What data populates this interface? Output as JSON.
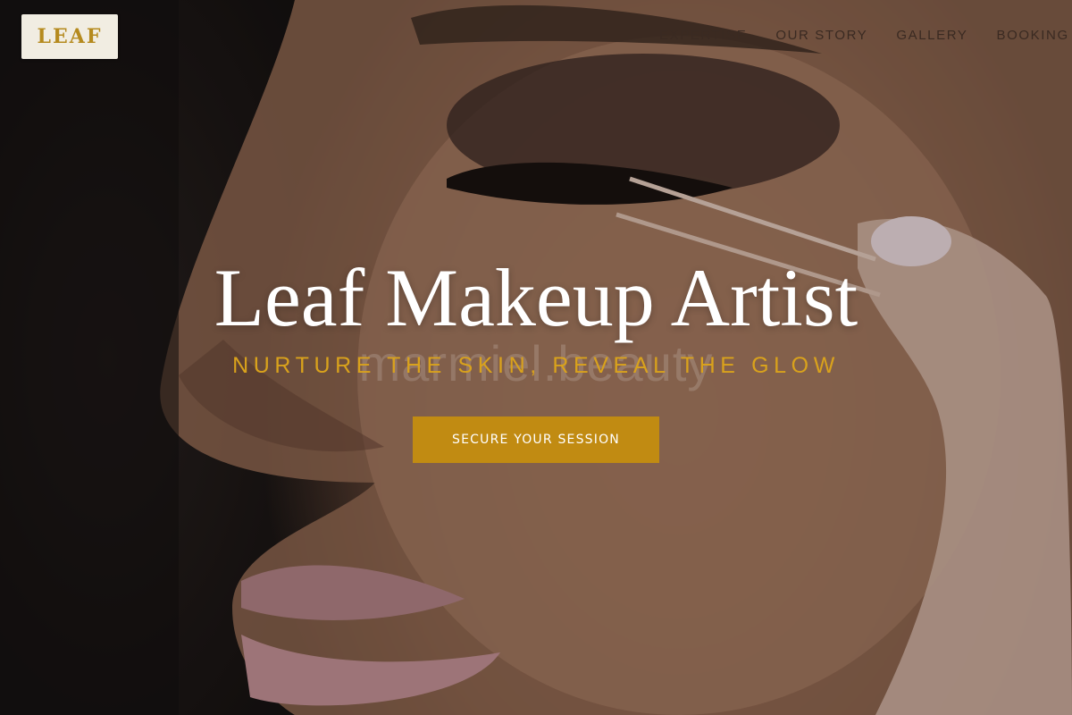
{
  "brand": {
    "logo_text": "LEAF",
    "accent": "#c18b12"
  },
  "nav": {
    "items": [
      {
        "label": "EXPERTISE"
      },
      {
        "label": "OUR STORY"
      },
      {
        "label": "GALLERY"
      },
      {
        "label": "BOOKING"
      }
    ]
  },
  "hero": {
    "title": "Leaf Makeup Artist",
    "tagline": "NURTURE THE SKIN, REVEAL THE GLOW",
    "watermark": "marmiel.beauty",
    "cta_label": "SECURE YOUR SESSION"
  }
}
